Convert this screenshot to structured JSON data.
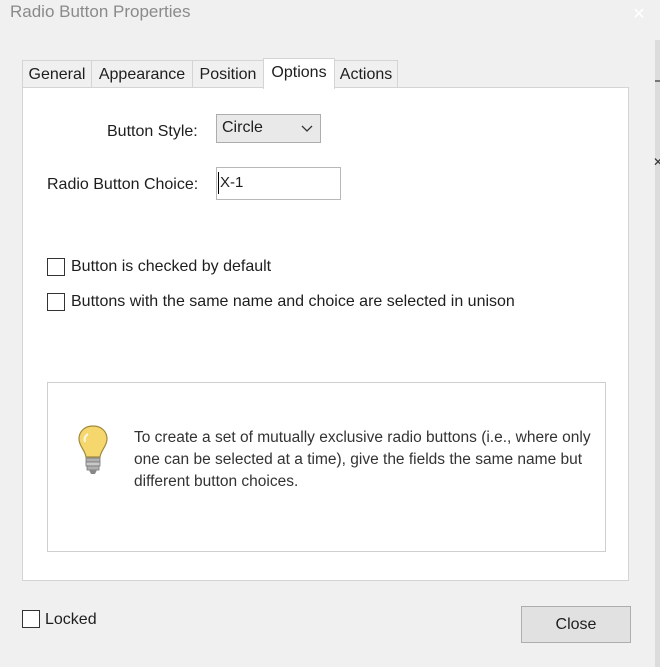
{
  "window": {
    "title": "Radio Button Properties",
    "close_glyph": "✕"
  },
  "tabs": [
    {
      "label": "General",
      "active": false
    },
    {
      "label": "Appearance",
      "active": false
    },
    {
      "label": "Position",
      "active": false
    },
    {
      "label": "Options",
      "active": true
    },
    {
      "label": "Actions",
      "active": false
    }
  ],
  "options": {
    "button_style_label": "Button Style:",
    "button_style_value": "Circle",
    "choice_label": "Radio Button Choice:",
    "choice_value": "X-1",
    "checked_default_label": "Button is checked by default",
    "checked_default_value": false,
    "unison_label": "Buttons with the same name and choice are selected in unison",
    "unison_value": false,
    "info_icon": "lightbulb-icon",
    "info_text": "To create a set of mutually exclusive radio buttons (i.e., where only one can be selected at a time), give the fields the same name but different button choices."
  },
  "footer": {
    "locked_label": "Locked",
    "locked_value": false,
    "close_label": "Close"
  },
  "colors": {
    "window_bg": "#f0f0f0",
    "panel_bg": "#ffffff",
    "bulb": "#f5d76e"
  }
}
